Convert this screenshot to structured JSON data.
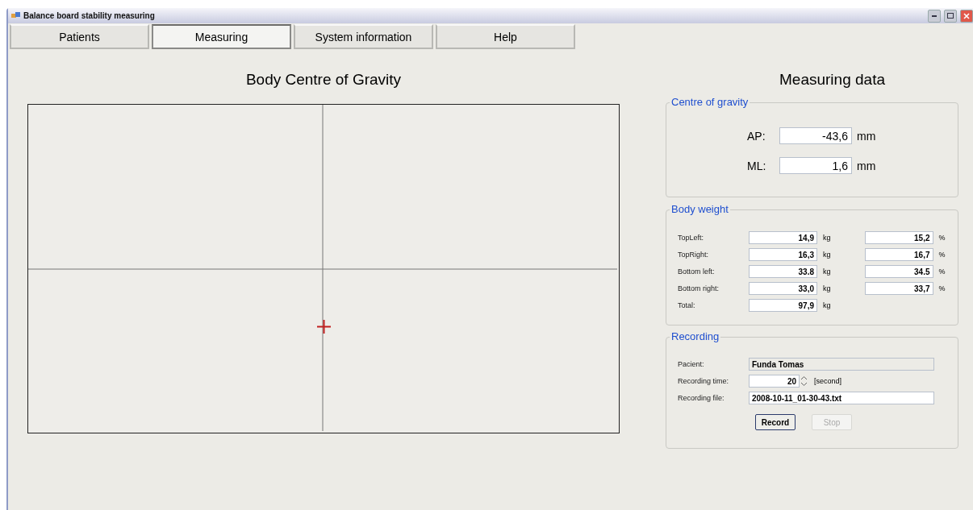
{
  "window": {
    "title": "Balance board stability measuring"
  },
  "tabs": [
    {
      "label": "Patients",
      "selected": false
    },
    {
      "label": "Measuring",
      "selected": true
    },
    {
      "label": "System information",
      "selected": false
    },
    {
      "label": "Help",
      "selected": false
    }
  ],
  "plot": {
    "title": "Body Centre of Gravity"
  },
  "panel_title": "Measuring data",
  "centre_of_gravity": {
    "title": "Centre of gravity",
    "rows": [
      {
        "label": "AP:",
        "value": "-43,6",
        "unit": "mm"
      },
      {
        "label": "ML:",
        "value": "1,6",
        "unit": "mm"
      }
    ]
  },
  "body_weight": {
    "title": "Body weight",
    "rows": [
      {
        "label": "TopLeft:",
        "weight": "14,9",
        "weight_unit": "kg",
        "percent": "15,2",
        "percent_unit": "%"
      },
      {
        "label": "TopRight:",
        "weight": "16,3",
        "weight_unit": "kg",
        "percent": "16,7",
        "percent_unit": "%"
      },
      {
        "label": "Bottom left:",
        "weight": "33.8",
        "weight_unit": "kg",
        "percent": "34.5",
        "percent_unit": "%"
      },
      {
        "label": "Bottom right:",
        "weight": "33,0",
        "weight_unit": "kg",
        "percent": "33,7",
        "percent_unit": "%"
      },
      {
        "label": "Total:",
        "weight": "97,9",
        "weight_unit": "kg"
      }
    ]
  },
  "recording": {
    "title": "Recording",
    "patient_label": "Pacient:",
    "patient": "Funda Tomas",
    "time_label": "Recording time:",
    "time": "20",
    "time_unit": "[second]",
    "file_label": "Recording file:",
    "file": "2008-10-11_01-30-43.txt",
    "buttons": [
      {
        "label": "Record",
        "disabled": false
      },
      {
        "label": "Stop",
        "disabled": true
      }
    ]
  }
}
